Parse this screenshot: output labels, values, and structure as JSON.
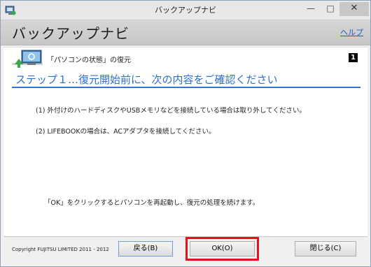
{
  "window": {
    "title": "バックアップナビ",
    "controls": {
      "minimize": "—",
      "maximize": "□",
      "close": "✕"
    }
  },
  "header": {
    "title": "バックアップナビ",
    "help_link": "ヘルプ"
  },
  "main": {
    "section_label": "「パソコンの状態」の復元",
    "step_badge": "1",
    "step_heading": "ステップ１…復元開始前に、次の内容をご確認ください",
    "instructions": [
      "(1) 外付けのハードディスクやUSBメモリなどを接続している場合は取り外してください。",
      "(2) LIFEBOOKの場合は、ACアダプタを接続してください。"
    ],
    "footer_note": "「OK」をクリックするとパソコンを再起動し、復元の処理を続けます。"
  },
  "footer": {
    "copyright": "Copyright FUJITSU LIMITED 2011 - 2012",
    "back_button": "戻る(B)",
    "ok_button": "OK(O)",
    "close_button": "閉じる(C)"
  },
  "icons": {
    "app": "app-backup-icon",
    "step": "computer-restore-icon"
  },
  "colors": {
    "heading_blue": "#2f6fd0",
    "highlight_red": "#e8101a",
    "link_blue": "#1f5fbf"
  }
}
